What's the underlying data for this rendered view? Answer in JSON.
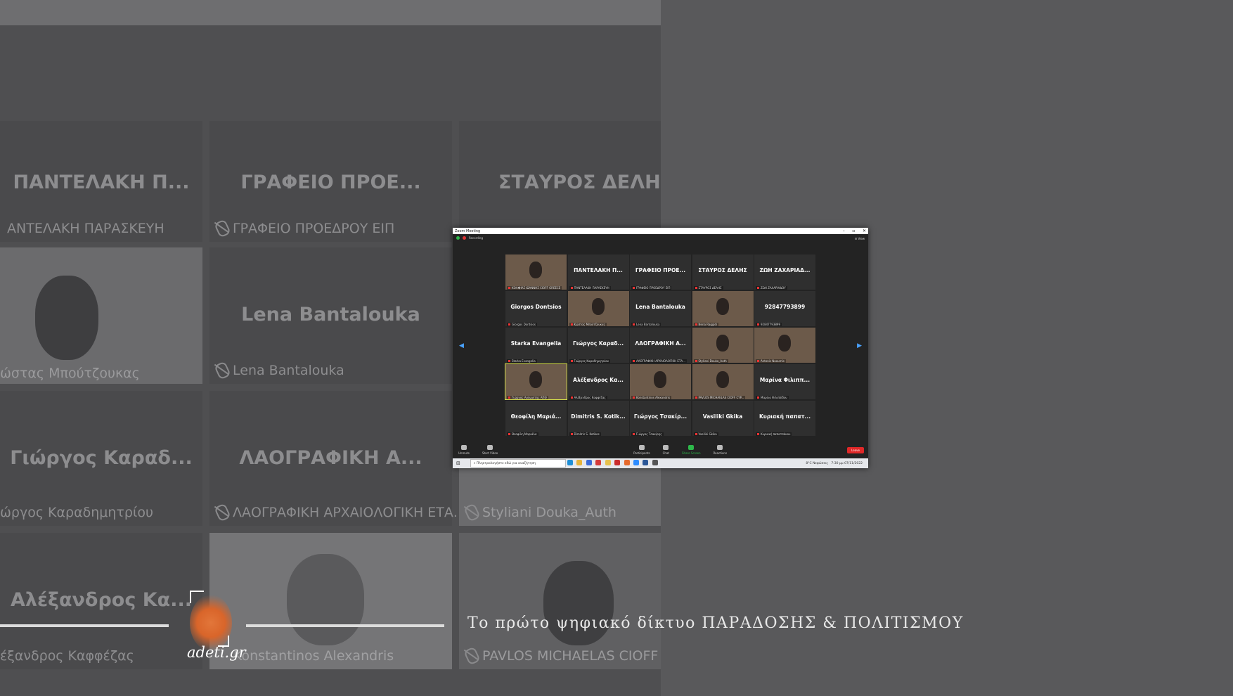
{
  "background": {
    "tiles": [
      {
        "name": "ΠΑΝΤΕΛΑΚΗ Π...",
        "label": "ΑΝΤΕΛΑΚΗ ΠΑΡΑΣΚΕΥΗ"
      },
      {
        "name": "ΓΡΑΦΕΙΟ ΠΡΟΕ...",
        "label": "ΓΡΑΦΕΙΟ ΠΡΟΕΔΡΟΥ ΕΙΠ"
      },
      {
        "name": "ΣΤΑΥΡΟΣ ΔΕΛΗΣ",
        "label": ""
      },
      {
        "name": "",
        "label": "ώστας Μπούτζουκας"
      },
      {
        "name": "Lena Bantalouka",
        "label": "Lena Bantalouka"
      },
      {
        "name": "Γιώργος Καραδ...",
        "label": "ώργος Καραδημητρίου"
      },
      {
        "name": "ΛΑΟΓΡΑΦΙΚΗ Α...",
        "label": "ΛΑΟΓΡΑΦΙΚΗ ΑΡΧΑΙΟΛΟΓΙΚΗ ΕΤΑ..."
      },
      {
        "name": "",
        "label": "Styliani Douka_Auth"
      },
      {
        "name": "Αλέξανδρος Κα...",
        "label": "έξανδρος Καφφέζας"
      },
      {
        "name": "",
        "label": "Konstantinos Alexandris"
      },
      {
        "name": "",
        "label": "PAVLOS MICHAELAS CIOFF C"
      }
    ]
  },
  "zoom": {
    "title": "Zoom Meeting",
    "recording": "Recording",
    "view_label": "View",
    "participants": [
      {
        "name": "",
        "label": "ΚΟΛ�ΙΑΣ ΙΩΑΝΝΗΣ CIOFF GREECE",
        "video": true
      },
      {
        "name": "ΠΑΝΤΕΛΑΚΗ Π...",
        "label": "ΠΑΝΤΕΛΑΚΗ ΠΑΡΑΣΚΕΥΗ",
        "video": false
      },
      {
        "name": "ΓΡΑΦΕΙΟ ΠΡΟΕ...",
        "label": "ΓΡΑΦΕΙΟ ΠΡΟΕΔΡΟΥ ΕΙΠ",
        "video": false
      },
      {
        "name": "ΣΤΑΥΡΟΣ ΔΕΛΗΣ",
        "label": "ΣΤΑΥΡΟΣ ΔΕΛΗΣ",
        "video": false
      },
      {
        "name": "ΖΩΗ ΖΑΧΑΡΙΑΔ...",
        "label": "ΖΩΗ ΖΑΧΑΡΙΑΔΟΥ",
        "video": false
      },
      {
        "name": "Giorgos Dontsios",
        "label": "Giorgos Dontsios",
        "video": false
      },
      {
        "name": "",
        "label": "Κώστας Μπούτζουκας",
        "video": true
      },
      {
        "name": "Lena Bantalouka",
        "label": "Lena Bantalouka",
        "video": false
      },
      {
        "name": "",
        "label": "Nena Raggidi",
        "video": true
      },
      {
        "name": "92847793899",
        "label": "92847793899",
        "video": false
      },
      {
        "name": "Starka Evangelia",
        "label": "Starka Evangelia",
        "video": false
      },
      {
        "name": "Γιώργος Καραδ...",
        "label": "Γιώργος Καραδημητρίου",
        "video": false
      },
      {
        "name": "ΛΑΟΓΡΑΦΙΚΗ Α...",
        "label": "ΛΑΟΓΡΑΦΙΚΗ ΑΡΧΑΙΟΛΟΓΙΚΗ ΕΤΑ...",
        "video": false
      },
      {
        "name": "",
        "label": "Styliani Douka_Auth",
        "video": true
      },
      {
        "name": "",
        "label": "Antonis Naoumis",
        "video": true
      },
      {
        "name": "",
        "label": "Γιώργος Αυλωνίτης ΑΠΘ",
        "video": true,
        "active": true
      },
      {
        "name": "Αλέξανδρος Κα...",
        "label": "Αλέξανδρος Καφφέζας",
        "video": false
      },
      {
        "name": "",
        "label": "Konstantinos Alexandris",
        "video": true
      },
      {
        "name": "",
        "label": "PAVLOS MICHAELAS CIOFF CYP...",
        "video": true
      },
      {
        "name": "Μαρίνα Φιλιππ...",
        "label": "Μαρίνα Φιλιππίδου",
        "video": false
      },
      {
        "name": "Θεοφίλη Μαριά...",
        "label": "Θεοφίλη Μαριάλα",
        "video": false
      },
      {
        "name": "Dimitris S. Kotik...",
        "label": "Dimitris S. Kotikos",
        "video": false
      },
      {
        "name": "Γιώργος Τσακίρ...",
        "label": "Γιώργος Τσακίρης",
        "video": false
      },
      {
        "name": "Vasiliki Gkika",
        "label": "Vasiliki Gkika",
        "video": false
      },
      {
        "name": "Κυριακή παπατ...",
        "label": "Κυριακή παπατσάκου",
        "video": false
      }
    ],
    "toolbar": {
      "unmute": "Unmute",
      "start_video": "Start Video",
      "participants": "Participants",
      "participants_count": "37",
      "chat": "Chat",
      "share_screen": "Share Screen",
      "reactions": "Reactions",
      "leave": "Leave"
    },
    "taskbar": {
      "search_placeholder": "Πληκτρολογήστε εδώ για αναζήτηση",
      "weather": "8°C Νεφώσεις",
      "time": "7:30 μμ",
      "date": "07/11/2022"
    }
  },
  "overlay": {
    "logo_text": "adeti.gr",
    "tagline": "Το πρώτο ψηφιακό δίκτυο ΠΑΡΑΔΟΣΗΣ & ΠΟΛΙΤΙΣΜΟΥ"
  }
}
